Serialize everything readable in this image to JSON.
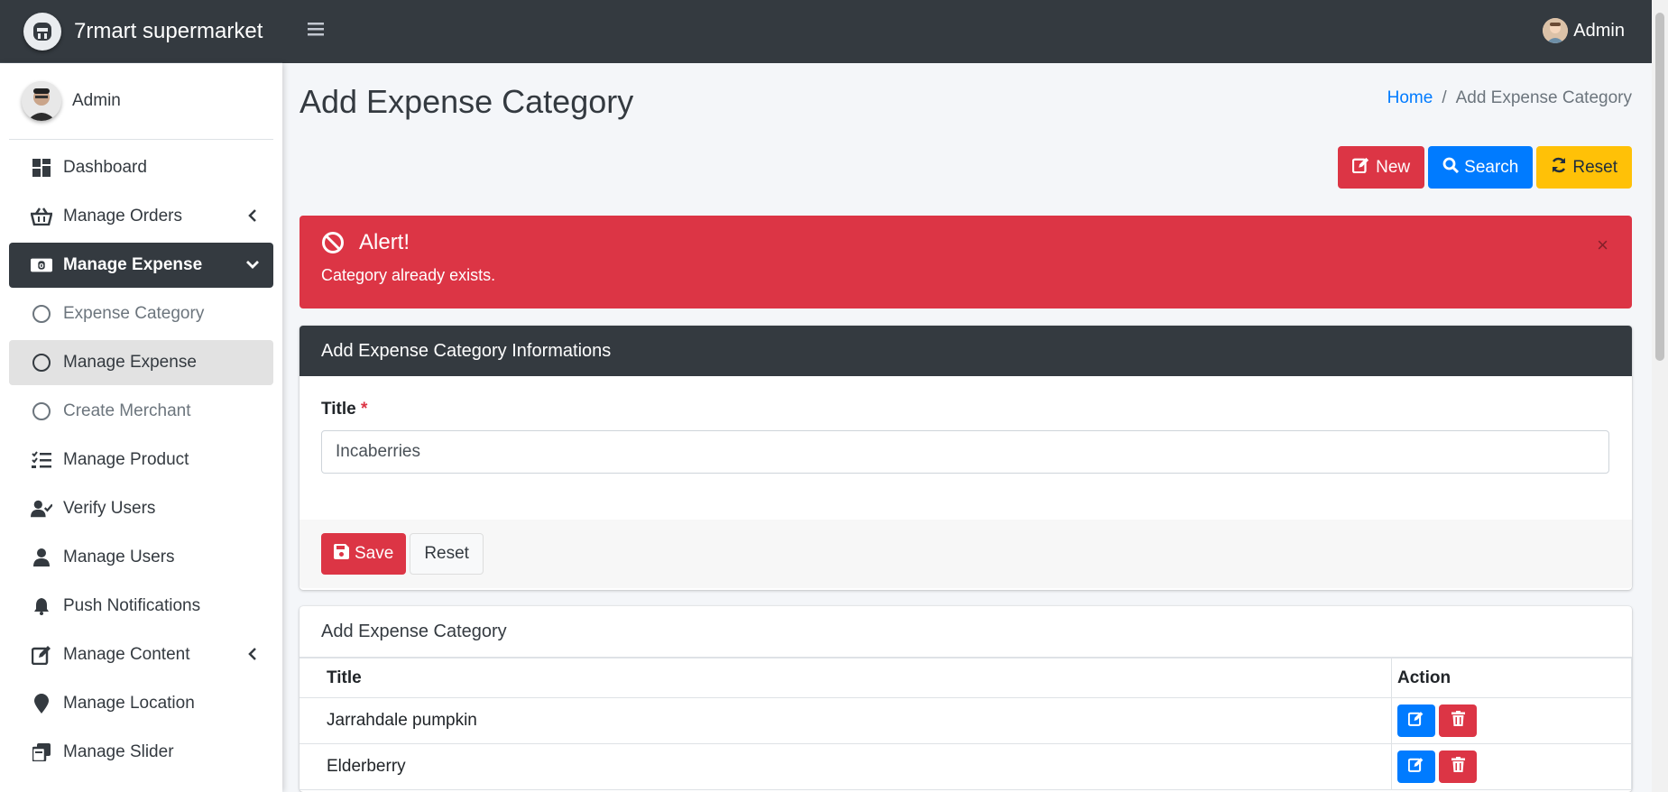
{
  "app": {
    "brand": "7rmart supermarket"
  },
  "topbar": {
    "user": "Admin"
  },
  "sidebar": {
    "user": "Admin",
    "items": [
      {
        "label": "Dashboard",
        "icon": "dashboard-icon"
      },
      {
        "label": "Manage Orders",
        "icon": "basket-icon"
      },
      {
        "label": "Manage Expense",
        "icon": "money-icon"
      },
      {
        "label": "Expense Category",
        "icon": "circle-icon"
      },
      {
        "label": "Manage Expense",
        "icon": "circle-icon"
      },
      {
        "label": "Create Merchant",
        "icon": "circle-icon"
      },
      {
        "label": "Manage Product",
        "icon": "tasks-icon"
      },
      {
        "label": "Verify Users",
        "icon": "user-check-icon"
      },
      {
        "label": "Manage Users",
        "icon": "user-icon"
      },
      {
        "label": "Push Notifications",
        "icon": "bell-icon"
      },
      {
        "label": "Manage Content",
        "icon": "edit-icon"
      },
      {
        "label": "Manage Location",
        "icon": "map-marker-icon"
      },
      {
        "label": "Manage Slider",
        "icon": "slider-icon"
      }
    ]
  },
  "page": {
    "title": "Add Expense Category",
    "breadcrumb": {
      "home": "Home",
      "sep": "/",
      "current": "Add Expense Category"
    }
  },
  "actions": {
    "new": "New",
    "search": "Search",
    "reset": "Reset"
  },
  "alert": {
    "title": "Alert!",
    "message": "Category already exists.",
    "close": "×"
  },
  "form": {
    "header": "Add Expense Category Informations",
    "title_label": "Title",
    "required_mark": "*",
    "title_value": "Incaberries",
    "save": "Save",
    "reset": "Reset"
  },
  "table": {
    "title": "Add Expense Category",
    "columns": [
      "Title",
      "Action"
    ],
    "rows": [
      {
        "title": "Jarrahdale pumpkin"
      },
      {
        "title": "Elderberry"
      }
    ]
  },
  "colors": {
    "primary": "#007bff",
    "danger": "#dc3545",
    "warning": "#ffc107",
    "dark": "#343a40"
  }
}
